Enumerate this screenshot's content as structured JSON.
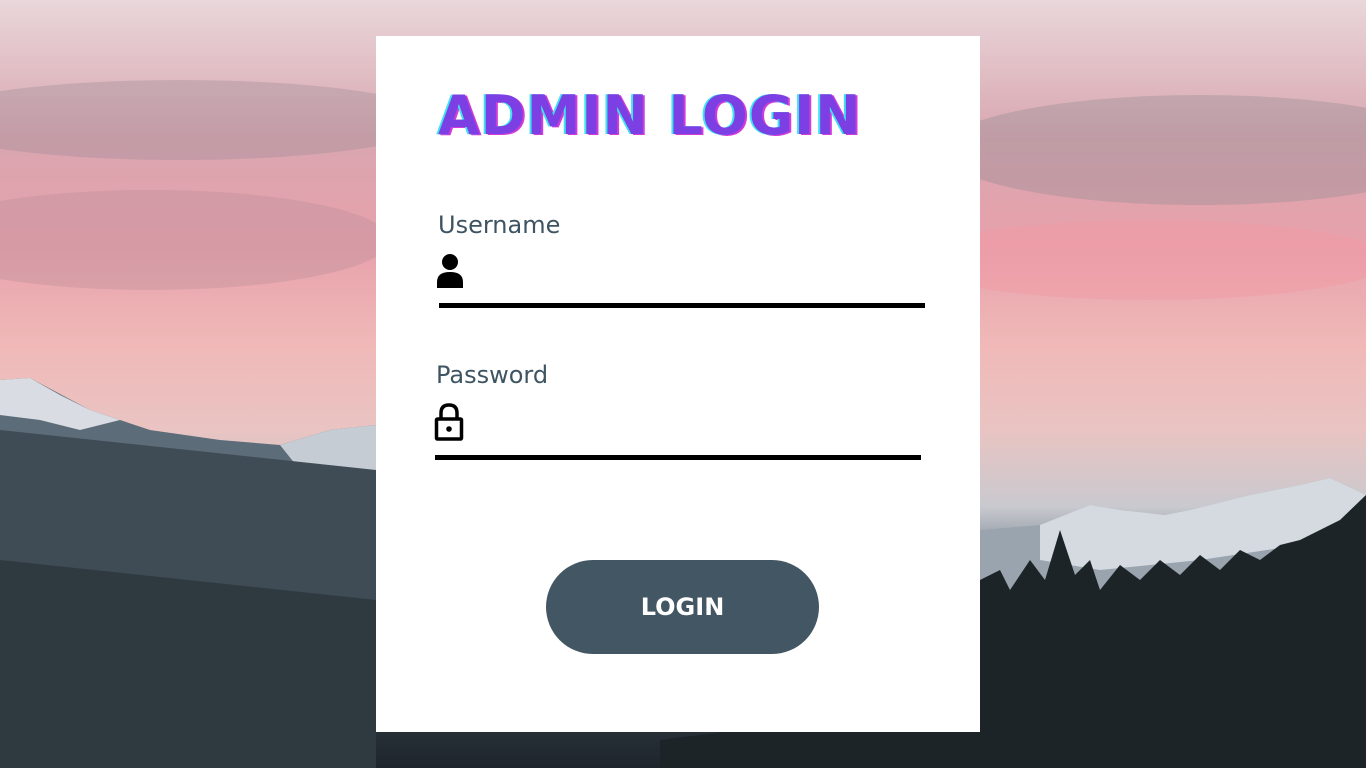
{
  "page": {
    "title": "ADMIN LOGIN"
  },
  "username": {
    "label": "Username",
    "value": "",
    "icon": "user-icon"
  },
  "password": {
    "label": "Password",
    "value": "",
    "icon": "lock-icon"
  },
  "actions": {
    "login_label": "LOGIN"
  },
  "colors": {
    "title": "#7b3fe4",
    "title_shadow_cyan": "#3ce3f0",
    "title_shadow_magenta": "#d03bd9",
    "label": "#3f5462",
    "button": "#435663",
    "button_text": "#ffffff"
  }
}
